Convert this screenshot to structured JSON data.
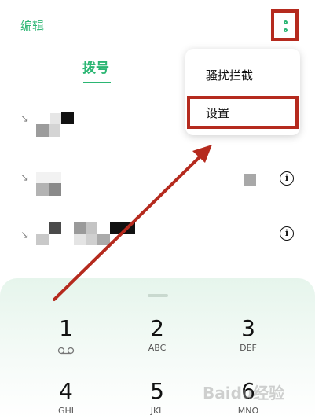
{
  "header": {
    "edit_label": "编辑",
    "menu_icon": "more-vertical-icon"
  },
  "tabs": [
    {
      "label": "拨号",
      "active": true
    }
  ],
  "popup_menu": {
    "items": [
      {
        "label": "骚扰拦截"
      },
      {
        "label": "设置",
        "highlighted": true
      }
    ]
  },
  "call_log": {
    "rows": [
      {
        "direction_icon": "incoming-call-arrow-icon",
        "has_info_button": false
      },
      {
        "direction_icon": "incoming-call-arrow-icon",
        "has_info_button": true
      },
      {
        "direction_icon": "incoming-call-arrow-icon",
        "has_info_button": true
      }
    ]
  },
  "dialpad": {
    "keys": [
      {
        "digit": "1",
        "letters": "",
        "icon": "voicemail-icon"
      },
      {
        "digit": "2",
        "letters": "ABC"
      },
      {
        "digit": "3",
        "letters": "DEF"
      },
      {
        "digit": "4",
        "letters": "GHI"
      },
      {
        "digit": "5",
        "letters": "JKL"
      },
      {
        "digit": "6",
        "letters": "MNO"
      }
    ]
  },
  "watermark": {
    "text": "Baidu经验"
  },
  "colors": {
    "accent": "#2bb673",
    "highlight_border": "#b52a1e",
    "arrow": "#b52a1e"
  }
}
